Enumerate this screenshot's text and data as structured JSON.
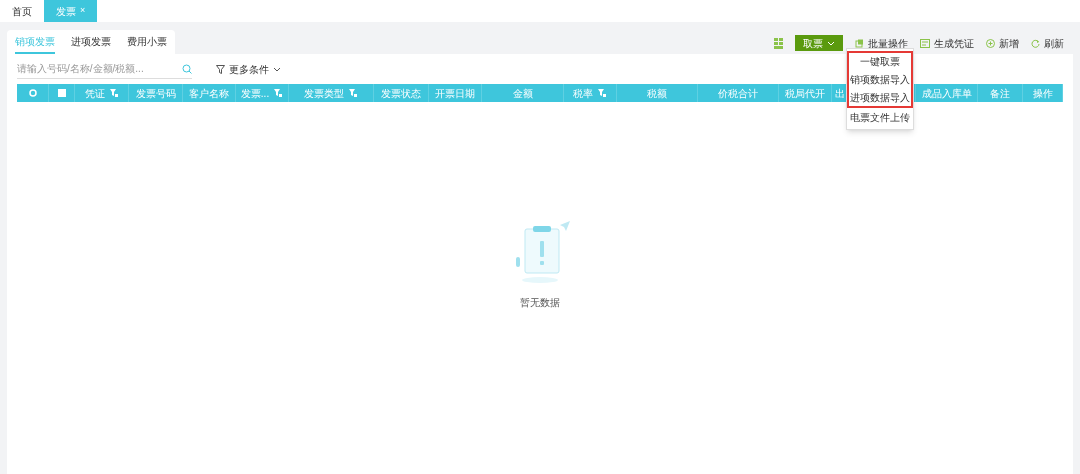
{
  "top_tabs": [
    {
      "label": "首页",
      "selected": false,
      "closable": false
    },
    {
      "label": "发票",
      "selected": true,
      "closable": true,
      "close": "×"
    }
  ],
  "sub_tabs": [
    {
      "label": "销项发票",
      "selected": true
    },
    {
      "label": "进项发票",
      "selected": false
    },
    {
      "label": "费用小票",
      "selected": false
    }
  ],
  "search": {
    "placeholder": "请输入号码/名称/金额/税额..."
  },
  "more_filter": "更多条件",
  "toolbar": {
    "primary": {
      "label": "取票",
      "expanded": true
    },
    "actions": [
      {
        "kind": "batch",
        "label": "批量操作"
      },
      {
        "kind": "voucher",
        "label": "生成凭证"
      },
      {
        "kind": "add",
        "label": "新增"
      },
      {
        "kind": "refresh",
        "label": "刷新"
      }
    ]
  },
  "dropdown": {
    "items": [
      {
        "label": "一键取票",
        "highlighted": true
      },
      {
        "label": "销项数据导入",
        "highlighted": true
      },
      {
        "label": "进项数据导入",
        "highlighted": true
      },
      {
        "label": "电票文件上传",
        "highlighted": false
      }
    ]
  },
  "table": {
    "columns": [
      {
        "kind": "settings"
      },
      {
        "kind": "checkbox",
        "checked": false
      },
      {
        "label": "凭证",
        "filter": true
      },
      {
        "label": "发票号码",
        "filter": false
      },
      {
        "label": "客户名称",
        "filter": false
      },
      {
        "label": "发票...",
        "filter": true
      },
      {
        "label": "发票类型",
        "filter": true
      },
      {
        "label": "发票状态",
        "filter": false
      },
      {
        "label": "开票日期",
        "filter": false
      },
      {
        "label": "金额",
        "filter": false
      },
      {
        "label": "税率",
        "filter": true
      },
      {
        "label": "税额",
        "filter": false
      },
      {
        "label": "价税合计",
        "filter": false
      },
      {
        "label": "税局代开",
        "filter": false
      },
      {
        "label": "出",
        "filter": false
      },
      {
        "label": "成品入库单",
        "filter": false
      },
      {
        "label": "备注",
        "filter": false
      },
      {
        "label": "操作",
        "filter": false
      }
    ],
    "empty_text": "暂无数据"
  }
}
